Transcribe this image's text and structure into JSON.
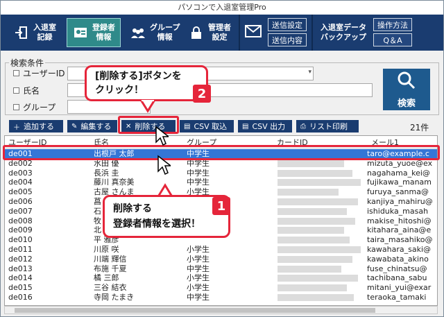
{
  "window": {
    "title": "パソコンで入退室管理Pro"
  },
  "toolbar": {
    "buttons": [
      {
        "label": "入退室\n記録",
        "icon": "door-exit-icon"
      },
      {
        "label": "登録者\n情報",
        "icon": "user-card-icon"
      },
      {
        "label": "グループ\n情報",
        "icon": "group-icon"
      },
      {
        "label": "管理者\n設定",
        "icon": "lock-icon"
      }
    ],
    "mail": {
      "icon": "envelope-icon",
      "send_settings": "送信設定",
      "send_contents": "送信内容"
    },
    "backup_label": "入退室データ\nバックアップ",
    "howto": "操作方法",
    "qa": "Q＆A"
  },
  "search": {
    "title": "検索条件",
    "user_id_label": "ユーザーID",
    "name_label": "氏名",
    "group_label": "グループ",
    "button_label": "検索"
  },
  "actions": {
    "add": "追加する",
    "edit": "編集する",
    "delete": "削除する",
    "csv_import": "CSV 取込",
    "csv_export": "CSV 出力",
    "print_list": "リスト印刷"
  },
  "count_label": "21件",
  "table": {
    "headers": [
      "ユーザーID",
      "氏名",
      "グループ",
      "カードID",
      "メール1"
    ],
    "rows": [
      {
        "id": "de001",
        "name": "出根戸 太郎",
        "group": "中学生",
        "mail": "taro@example.c"
      },
      {
        "id": "de002",
        "name": "水田 優",
        "group": "中学生",
        "mail": "mizuta_yuoe@ex"
      },
      {
        "id": "de003",
        "name": "長浜 圭",
        "group": "中学生",
        "mail": "nagahama_kei@"
      },
      {
        "id": "de004",
        "name": "藤川 真奈美",
        "group": "中学生",
        "mail": "fujikawa_manam"
      },
      {
        "id": "de005",
        "name": "古屋 さんま",
        "group": "小学生",
        "mail": "furuya_sanma@"
      },
      {
        "id": "de006",
        "name": "菖",
        "group": "",
        "mail": "kanjiya_mahiru@"
      },
      {
        "id": "de007",
        "name": "石",
        "group": "",
        "mail": "ishiduka_masah"
      },
      {
        "id": "de008",
        "name": "牧",
        "group": "",
        "mail": "makise_hitoshi@"
      },
      {
        "id": "de009",
        "name": "北",
        "group": "",
        "mail": "kitahara_aina@e"
      },
      {
        "id": "de010",
        "name": "平 雅彦",
        "group": "",
        "mail": "taira_masahiko@"
      },
      {
        "id": "de011",
        "name": "川原 咲",
        "group": "小学生",
        "mail": "kawahara_saki@"
      },
      {
        "id": "de012",
        "name": "川端 輝信",
        "group": "小学生",
        "mail": "kawabata_akino"
      },
      {
        "id": "de013",
        "name": "布施 千夏",
        "group": "中学生",
        "mail": "fuse_chinatsu@"
      },
      {
        "id": "de014",
        "name": "橘 三郎",
        "group": "小学生",
        "mail": "tachibana_sabu"
      },
      {
        "id": "de015",
        "name": "三谷 結衣",
        "group": "小学生",
        "mail": "mitani_yui@exar"
      },
      {
        "id": "de016",
        "name": "寺岡 たまき",
        "group": "中学生",
        "mail": "teraoka_tamaki"
      }
    ]
  },
  "callouts": {
    "one_number": "1",
    "one_line1": "削除する",
    "one_line2": "登録者情報を選択！",
    "two_number": "2",
    "two_line1": "[削除する]ボタンを",
    "two_line2": "クリック！"
  },
  "colors": {
    "accent": "#e5253a",
    "toolbar": "#1a3c70",
    "selection": "#3476d6"
  }
}
